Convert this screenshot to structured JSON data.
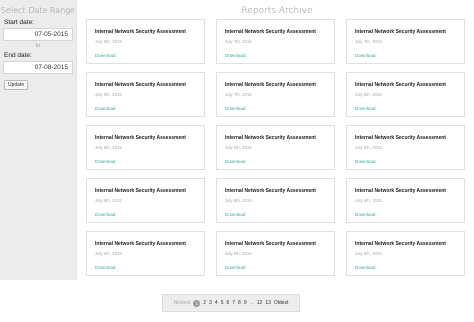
{
  "sidebar": {
    "title": "Select Date Range",
    "start_label": "Start date:",
    "start_value": "07-05-2015",
    "to_text": "to",
    "end_label": "End date:",
    "end_value": "07-08-2015",
    "update_label": "Update"
  },
  "main": {
    "title": "Reports Archive",
    "reports": [
      {
        "title": "Internal Network Security Assessment",
        "date": "July 8th, 2015",
        "link": "Download"
      },
      {
        "title": "Internal Network Security Assessment",
        "date": "July 7th, 2015",
        "link": "Download"
      },
      {
        "title": "Internal Network Security Assessment",
        "date": "July 7th, 2015",
        "link": "Download"
      },
      {
        "title": "Internal Network Security Assessment",
        "date": "July 8th, 2015",
        "link": "Download"
      },
      {
        "title": "Internal Network Security Assessment",
        "date": "July 7th, 2015",
        "link": "Download"
      },
      {
        "title": "Internal Network Security Assessment",
        "date": "July 6th, 2015",
        "link": "Download"
      },
      {
        "title": "Internal Network Security Assessment",
        "date": "July 8th, 2015",
        "link": "Download"
      },
      {
        "title": "Internal Network Security Assessment",
        "date": "July 6th, 2015",
        "link": "Download"
      },
      {
        "title": "Internal Network Security Assessment",
        "date": "July 6th, 2015",
        "link": "Download"
      },
      {
        "title": "Internal Network Security Assessment",
        "date": "July 6th, 2015",
        "link": "Download"
      },
      {
        "title": "Internal Network Security Assessment",
        "date": "July 6th, 2015",
        "link": "Download"
      },
      {
        "title": "Internal Network Security Assessment",
        "date": "July 6th, 2015",
        "link": "Download"
      },
      {
        "title": "Internal Network Security Assessment",
        "date": "July 6th, 2015",
        "link": "Download"
      },
      {
        "title": "Internal Network Security Assessment",
        "date": "July 6th, 2015",
        "link": "Download"
      },
      {
        "title": "Internal Network Security Assessment",
        "date": "July 5th, 2015",
        "link": "Download"
      }
    ]
  },
  "pagination": {
    "newest": "Newest",
    "pages": [
      "1",
      "2",
      "3",
      "4",
      "5",
      "6",
      "7",
      "8",
      "9"
    ],
    "current": "1",
    "ellipsis": "...",
    "tail_pages": [
      "12",
      "13"
    ],
    "oldest": "Oldest"
  },
  "colors": {
    "accent_link": "#3aa89a",
    "sidebar_bg": "#ececec"
  }
}
